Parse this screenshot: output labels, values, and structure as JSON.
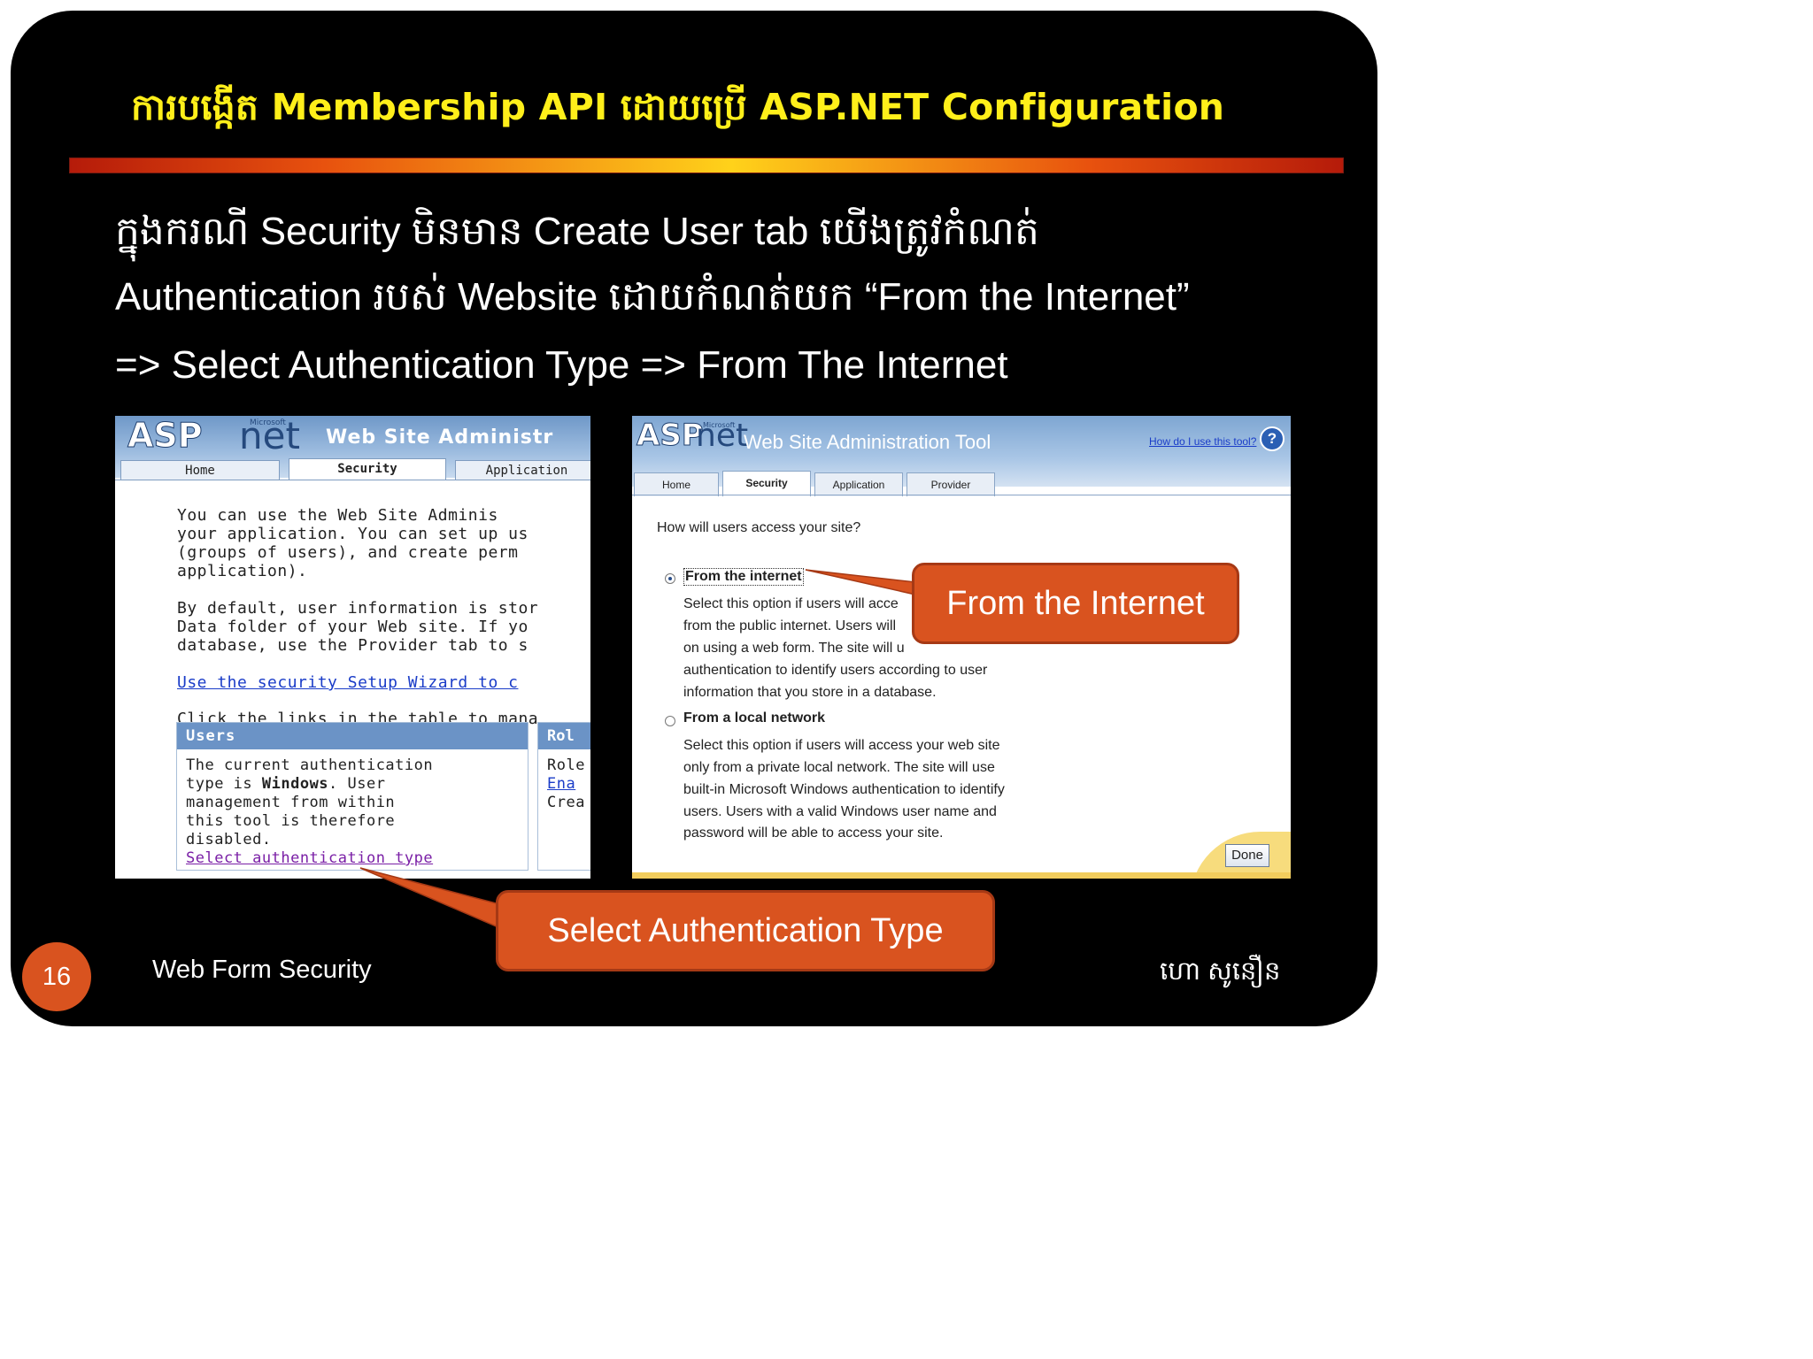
{
  "slide": {
    "title": "ការបង្កើត Membership API ដោយប្រើ ASP.NET Configuration",
    "body_line1": "ក្នុងករណី Security មិនមាន Create User tab យើងត្រូវកំណត់",
    "body_line2": "Authentication របស់ Website ដោយកំណត់យក “From the Internet”",
    "body_line3": "=> Select  Authentication Type => From The Internet",
    "page_number": "16",
    "footer_left": "Web Form Security",
    "footer_right": "ហោ សូនឿន",
    "colors": {
      "title": "#ffef1a",
      "callout": "#d9531f",
      "background": "#000000"
    }
  },
  "left_screenshot": {
    "logo_asp": "ASP",
    "logo_net": "net",
    "logo_microsoft": "Microsoft",
    "app_title": "Web Site Administr",
    "tabs": [
      "Home",
      "Security",
      "Application"
    ],
    "active_tab": "Security",
    "para1": [
      "You can use the Web Site Adminis",
      "your application. You can set up us",
      "(groups of users), and create perm",
      "application)."
    ],
    "para2": [
      "By default, user information is stor",
      "Data folder of your Web site. If yo",
      "database, use the Provider tab to s"
    ],
    "wizard_link": "Use the security Setup Wizard to c",
    "table_intro": "Click the links in the table to mana",
    "users_header": "Users",
    "users_text_1": "The current authentication",
    "users_text_2_prefix": "type is ",
    "users_text_2_bold": "Windows",
    "users_text_2_suffix": ". User",
    "users_text_3": "management from within",
    "users_text_4": "this tool is therefore",
    "users_text_5": "disabled.",
    "select_auth_link": "Select authentication type",
    "roles_header": "Rol",
    "roles_lines": [
      "Role",
      "Ena",
      "Crea"
    ]
  },
  "right_screenshot": {
    "logo_asp": "ASP",
    "logo_net": "net",
    "logo_microsoft": "Microsoft",
    "app_title": "Web Site Administration Tool",
    "help_link": "How do I use this tool?",
    "help_icon": "?",
    "tabs": [
      "Home",
      "Security",
      "Application",
      "Provider"
    ],
    "active_tab": "Security",
    "question": "How will users access your site?",
    "option1_label": "From the internet",
    "option1_selected": true,
    "option1_desc": [
      "Select this option if users will acce",
      "from the public internet. Users will",
      "on using a web form. The site will u",
      "authentication to identify users according to user",
      "information that you store in a database."
    ],
    "option2_label": "From a local network",
    "option2_selected": false,
    "option2_desc": [
      "Select this option if users will access your web site",
      "only from a private local network. The site will use",
      "built-in Microsoft Windows authentication to identify",
      "users. Users with a valid Windows user name and",
      "password will be able to access your site."
    ],
    "done_button": "Done"
  },
  "callouts": {
    "from_internet": "From the Internet",
    "select_auth_type": "Select Authentication Type"
  }
}
